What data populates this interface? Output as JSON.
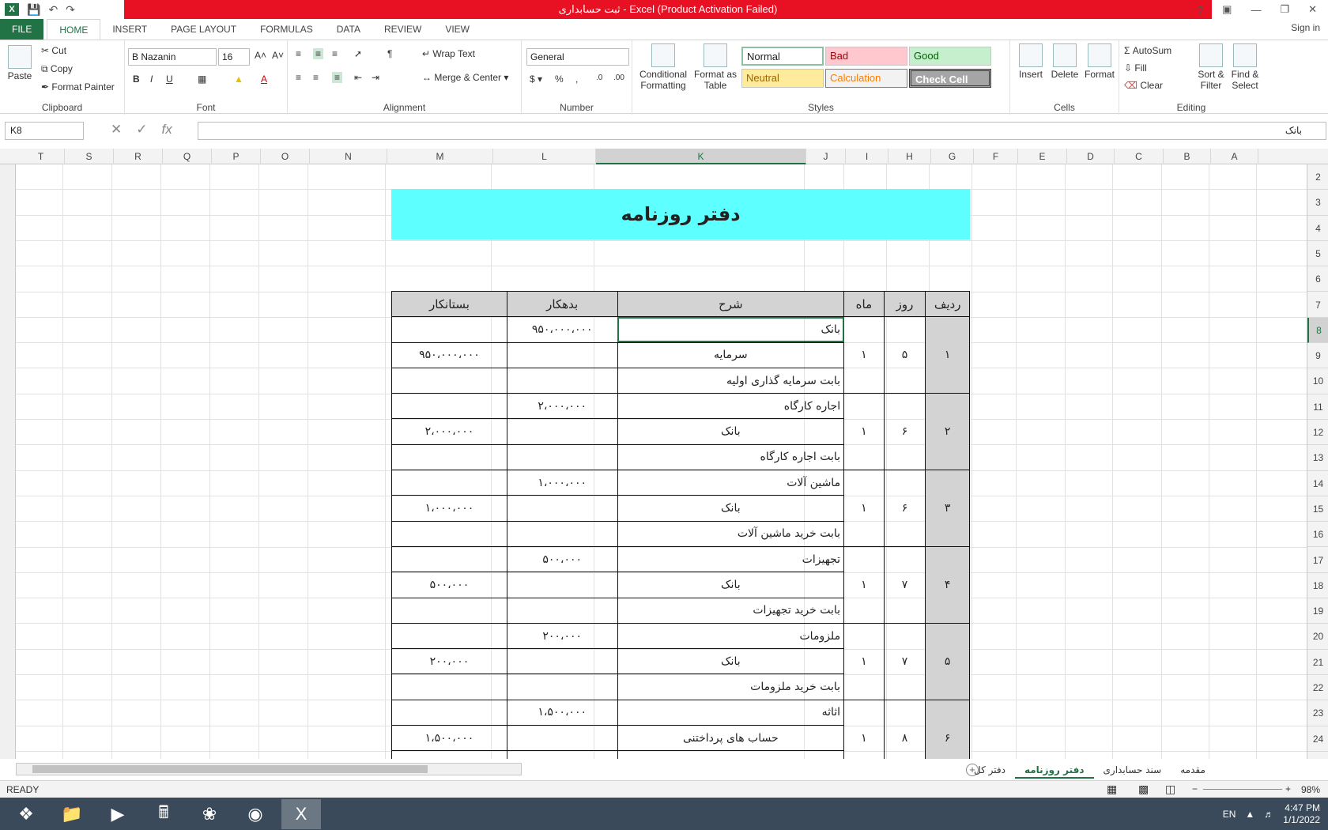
{
  "window": {
    "title": "ثبت حسابداری  -  Excel (Product Activation Failed)",
    "help": "?",
    "signin": "Sign in"
  },
  "tabs": [
    "FILE",
    "HOME",
    "INSERT",
    "PAGE LAYOUT",
    "FORMULAS",
    "DATA",
    "REVIEW",
    "VIEW"
  ],
  "ribbon": {
    "clipboard": {
      "label": "Clipboard",
      "paste": "Paste",
      "cut": "Cut",
      "copy": "Copy",
      "format_painter": "Format Painter"
    },
    "font": {
      "label": "Font",
      "name": "B Nazanin",
      "size": "16"
    },
    "alignment": {
      "label": "Alignment",
      "wrap": "Wrap Text",
      "merge": "Merge & Center"
    },
    "number": {
      "label": "Number",
      "format": "General"
    },
    "styles": {
      "label": "Styles",
      "conditional": "Conditional Formatting",
      "format_table": "Format as Table",
      "normal": "Normal",
      "bad": "Bad",
      "good": "Good",
      "neutral": "Neutral",
      "calculation": "Calculation",
      "check": "Check Cell"
    },
    "cells": {
      "label": "Cells",
      "insert": "Insert",
      "delete": "Delete",
      "format": "Format"
    },
    "editing": {
      "label": "Editing",
      "autosum": "AutoSum",
      "fill": "Fill",
      "clear": "Clear",
      "sort": "Sort & Filter",
      "find": "Find & Select"
    }
  },
  "formula_bar": {
    "name_box": "K8",
    "value": "بانک"
  },
  "columns": [
    "T",
    "S",
    "R",
    "Q",
    "P",
    "O",
    "N",
    "M",
    "L",
    "K",
    "J",
    "I",
    "H",
    "G",
    "F",
    "E",
    "D",
    "C",
    "B",
    "A"
  ],
  "rows": [
    "2",
    "3",
    "4",
    "5",
    "6",
    "7",
    "8",
    "9",
    "10",
    "11",
    "12",
    "13",
    "14",
    "15",
    "16",
    "17",
    "18",
    "19",
    "20",
    "21",
    "22",
    "23",
    "24"
  ],
  "sheet": {
    "title": "دفتر روزنامه",
    "headers": {
      "radif": "ردیف",
      "rooz": "روز",
      "mah": "ماه",
      "sharh": "شرح",
      "bedehkar": "بدهکار",
      "bestankar": "بستانکار"
    },
    "entries": [
      {
        "radif": "۱",
        "rooz": "۵",
        "mah": "۱",
        "debit_acct": "بانک",
        "credit_acct": "سرمایه",
        "note": "بابت سرمایه گذاری اولیه",
        "debit": "۹۵۰،۰۰۰،۰۰۰",
        "credit": "۹۵۰،۰۰۰،۰۰۰"
      },
      {
        "radif": "۲",
        "rooz": "۶",
        "mah": "۱",
        "debit_acct": "اجاره کارگاه",
        "credit_acct": "بانک",
        "note": "بابت اجاره کارگاه",
        "debit": "۲،۰۰۰،۰۰۰",
        "credit": "۲،۰۰۰،۰۰۰"
      },
      {
        "radif": "۳",
        "rooz": "۶",
        "mah": "۱",
        "debit_acct": "ماشین آلات",
        "credit_acct": "بانک",
        "note": "بابت خرید ماشین آلات",
        "debit": "۱،۰۰۰،۰۰۰",
        "credit": "۱،۰۰۰،۰۰۰"
      },
      {
        "radif": "۴",
        "rooz": "۷",
        "mah": "۱",
        "debit_acct": "تجهیزات",
        "credit_acct": "بانک",
        "note": "بابت خرید تجهیزات",
        "debit": "۵۰۰،۰۰۰",
        "credit": "۵۰۰،۰۰۰"
      },
      {
        "radif": "۵",
        "rooz": "۷",
        "mah": "۱",
        "debit_acct": "ملزومات",
        "credit_acct": "بانک",
        "note": "بابت خرید ملزومات",
        "debit": "۲۰۰،۰۰۰",
        "credit": "۲۰۰،۰۰۰"
      },
      {
        "radif": "۶",
        "rooz": "۸",
        "mah": "۱",
        "debit_acct": "اثاثه",
        "credit_acct": "حساب های پرداختنی",
        "note": "",
        "debit": "۱،۵۰۰،۰۰۰",
        "credit": "۱،۵۰۰،۰۰۰"
      }
    ]
  },
  "sheet_tabs": [
    "مقدمه",
    "سند حسابداری",
    "دفتر روزنامه",
    "دفتر کل"
  ],
  "status": {
    "ready": "READY",
    "zoom": "98%"
  },
  "taskbar": {
    "lang": "EN",
    "time": "4:47 PM",
    "date": "1/1/2022"
  }
}
